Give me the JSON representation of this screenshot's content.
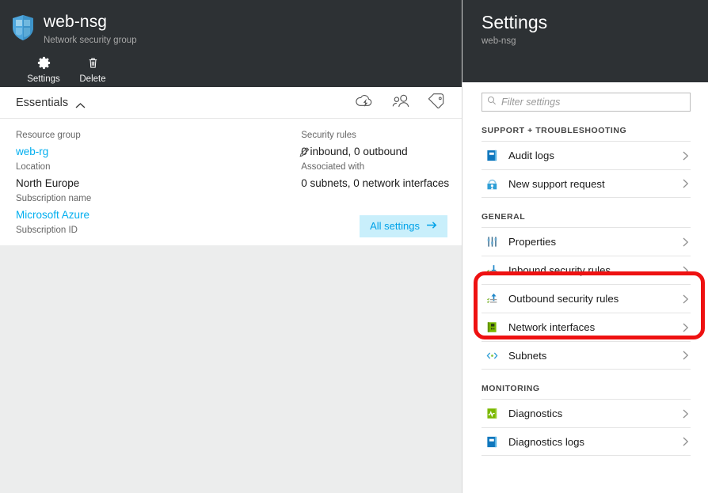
{
  "resource": {
    "name": "web-nsg",
    "type_label": "Network security group",
    "icon": "shield-icon"
  },
  "commands": [
    {
      "label": "Settings",
      "icon": "gear-icon"
    },
    {
      "label": "Delete",
      "icon": "trash-icon"
    }
  ],
  "essentials": {
    "title": "Essentials",
    "collapse_icon": "chevron-up-icon",
    "header_icons": [
      {
        "name": "monitor-cloud-icon"
      },
      {
        "name": "users-icon"
      },
      {
        "name": "tag-icon"
      }
    ],
    "left_fields": [
      {
        "label": "Resource group",
        "value": "web-rg",
        "is_link": true
      },
      {
        "label": "Location",
        "value": "North Europe",
        "is_link": false
      },
      {
        "label": "Subscription name",
        "value": "Microsoft Azure",
        "is_link": true
      },
      {
        "label": "Subscription ID",
        "value": "",
        "is_link": false
      }
    ],
    "right_fields": [
      {
        "label": "Security rules",
        "value": "0 inbound, 0 outbound"
      },
      {
        "label": "Associated with",
        "value": "0 subnets, 0 network interfaces"
      }
    ],
    "edit_icon": "pencil-icon",
    "all_settings_label": "All settings",
    "all_settings_arrow": "arrow-right-icon"
  },
  "settings_blade": {
    "title": "Settings",
    "subtitle": "web-nsg",
    "filter": {
      "placeholder": "Filter settings",
      "value": "",
      "icon": "search-icon"
    },
    "groups": [
      {
        "title": "SUPPORT + TROUBLESHOOTING",
        "items": [
          {
            "label": "Audit logs",
            "icon": "book-blue-icon"
          },
          {
            "label": "New support request",
            "icon": "support-headset-icon"
          }
        ]
      },
      {
        "title": "GENERAL",
        "items": [
          {
            "label": "Properties",
            "icon": "sliders-icon"
          },
          {
            "label": "Inbound security rules",
            "icon": "arrow-down-list-icon",
            "highlighted": true
          },
          {
            "label": "Outbound security rules",
            "icon": "arrow-up-list-icon",
            "highlighted": true
          },
          {
            "label": "Network interfaces",
            "icon": "nic-card-green-icon"
          },
          {
            "label": "Subnets",
            "icon": "angle-brackets-icon"
          }
        ]
      },
      {
        "title": "MONITORING",
        "items": [
          {
            "label": "Diagnostics",
            "icon": "diagnostics-green-icon"
          },
          {
            "label": "Diagnostics logs",
            "icon": "book-blue-icon"
          }
        ]
      }
    ]
  },
  "annotation": {
    "type": "red-rounded-rectangle",
    "color": "#ee1111"
  },
  "colors": {
    "header_dark": "#2d3134",
    "body_gray": "#eceded",
    "link_blue": "#00aeef",
    "accent_button_bg": "#c9effb",
    "accent_button_text": "#00a2e8",
    "annotation_red": "#ee1111"
  }
}
